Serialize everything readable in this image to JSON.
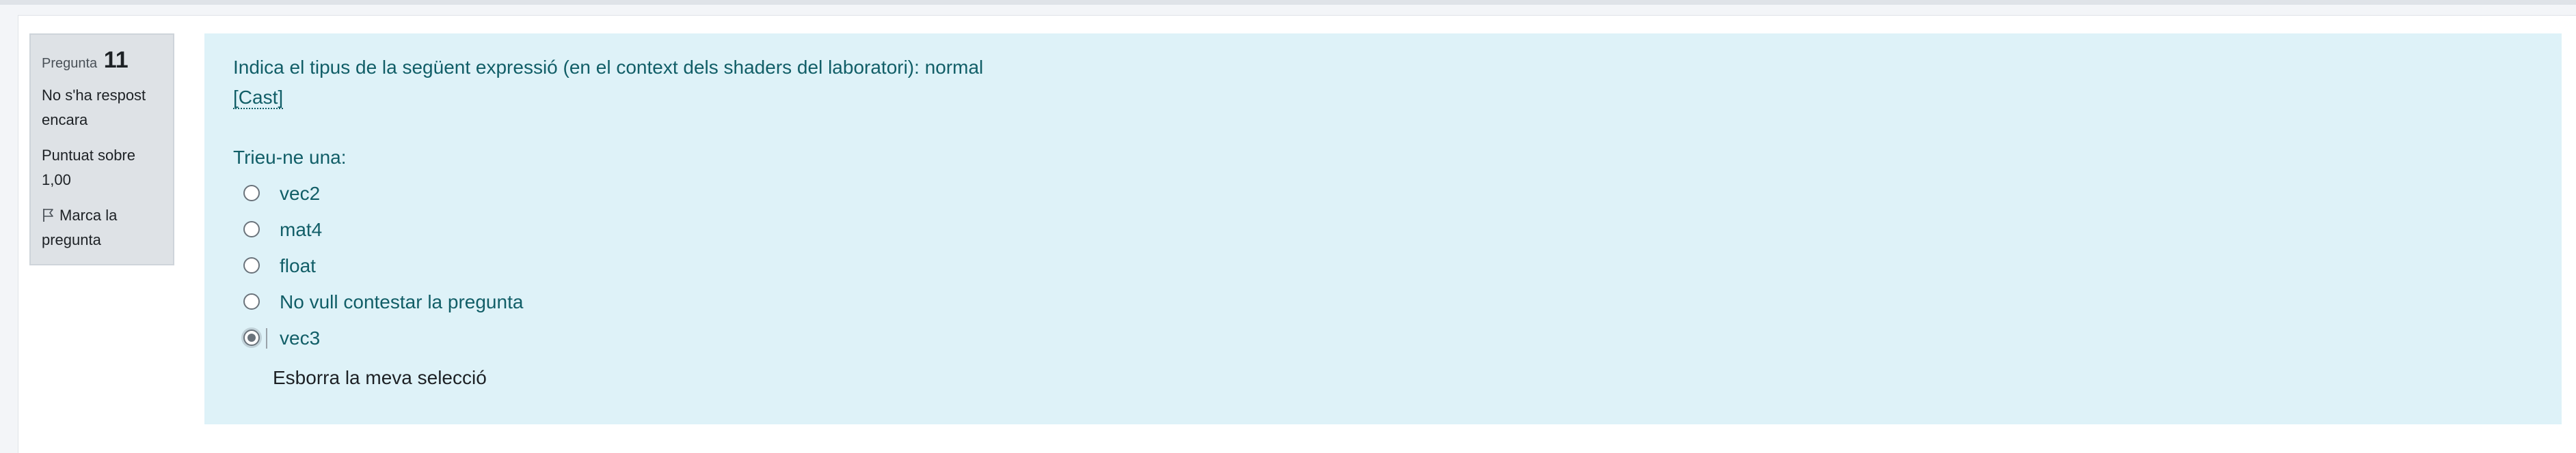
{
  "question_info": {
    "label": "Pregunta",
    "number": "11",
    "state": "No s'ha respost encara",
    "grade": "Puntuat sobre 1,00",
    "flag_label": "Marca la pregunta"
  },
  "question": {
    "text": "Indica el tipus de la següent expressió (en el context dels shaders del laboratori): normal",
    "link_label": "[Cast]",
    "prompt": "Trieu-ne una:",
    "options": [
      {
        "label": "vec2",
        "checked": false
      },
      {
        "label": "mat4",
        "checked": false
      },
      {
        "label": "float",
        "checked": false
      },
      {
        "label": "No vull contestar la pregunta",
        "checked": false
      },
      {
        "label": "vec3",
        "checked": true
      }
    ],
    "clear_label": "Esborra la meva selecció"
  },
  "icons": {
    "flag": "flag-outline-icon"
  },
  "colors": {
    "content_bg": "#def2f8",
    "content_text": "#115e67",
    "info_bg": "#dee2e6"
  }
}
